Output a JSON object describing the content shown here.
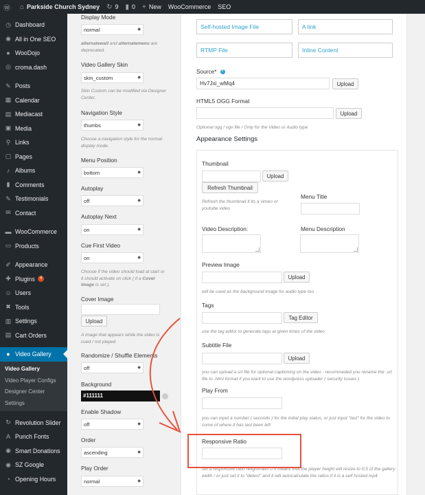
{
  "adminbar": {
    "site_name": "Parkside Church Sydney",
    "updates_count": "9",
    "comments_count": "0",
    "new_label": "New",
    "woocommerce_label": "WooCommerce",
    "seo_label": "SEO"
  },
  "sidebar": {
    "items": [
      {
        "label": "Dashboard",
        "icon": "dashboard-icon"
      },
      {
        "label": "All in One SEO",
        "icon": "seo-icon"
      },
      {
        "label": "WooDojo",
        "icon": "woodojo-icon"
      },
      {
        "label": "croma.dash",
        "icon": "croma-icon"
      },
      {
        "label": "Posts",
        "icon": "pin-icon"
      },
      {
        "label": "Calendar",
        "icon": "calendar-icon"
      },
      {
        "label": "Mediacast",
        "icon": "mediacast-icon"
      },
      {
        "label": "Media",
        "icon": "media-icon"
      },
      {
        "label": "Links",
        "icon": "links-icon"
      },
      {
        "label": "Pages",
        "icon": "pages-icon"
      },
      {
        "label": "Albums",
        "icon": "albums-icon"
      },
      {
        "label": "Comments",
        "icon": "comments-icon"
      },
      {
        "label": "Testimonials",
        "icon": "testimonials-icon"
      },
      {
        "label": "Contact",
        "icon": "contact-icon"
      },
      {
        "label": "WooCommerce",
        "icon": "woocommerce-icon"
      },
      {
        "label": "Products",
        "icon": "products-icon"
      },
      {
        "label": "Appearance",
        "icon": "appearance-icon"
      },
      {
        "label": "Plugins",
        "icon": "plugins-icon",
        "badge": "4"
      },
      {
        "label": "Users",
        "icon": "users-icon"
      },
      {
        "label": "Tools",
        "icon": "tools-icon"
      },
      {
        "label": "Settings",
        "icon": "settings-icon"
      },
      {
        "label": "Cart Orders",
        "icon": "cart-icon"
      },
      {
        "label": "Video Gallery",
        "icon": "video-gallery-icon",
        "active": true
      }
    ],
    "submenu": [
      "Video Gallery",
      "Video Player Configs",
      "Designer Center",
      "Settings"
    ],
    "items_after": [
      {
        "label": "Revolution Slider",
        "icon": "revolution-icon"
      },
      {
        "label": "Punch Fonts",
        "icon": "fonts-icon"
      },
      {
        "label": "Smart Donations",
        "icon": "donations-icon"
      },
      {
        "label": "SZ Google",
        "icon": "google-icon"
      },
      {
        "label": "Opening Hours",
        "icon": "clock-icon"
      }
    ]
  },
  "left_options": {
    "display_mode": {
      "label": "Display Mode",
      "value": "normal",
      "desc_bold1": "alternatewall",
      "desc_mid": " and ",
      "desc_bold2": "alternatemenu",
      "desc_tail": " are deprecated."
    },
    "skin": {
      "label": "Video Gallery Skin",
      "value": "skin_custom",
      "desc": "Skin Custom can be modified via Designer Center."
    },
    "navigation": {
      "label": "Navigation Style",
      "value": "thumbs",
      "desc": "Choose a navigation style for the normal display mode."
    },
    "menu_position": {
      "label": "Menu Position",
      "value": "bottom"
    },
    "autoplay": {
      "label": "Autoplay",
      "value": "off"
    },
    "autoplay_next": {
      "label": "Autoplay Next",
      "value": "on"
    },
    "cue_first": {
      "label": "Cue First Video",
      "value": "on",
      "desc_head": "Choose if the video should load at start or it should activate on click ( if a ",
      "desc_bold": "Cover Image",
      "desc_tail": " is set )."
    },
    "cover_image": {
      "label": "Cover Image",
      "upload": "Upload",
      "desc": "A image that appears while the video is cued / not played"
    },
    "randomize": {
      "label": "Randomize / Shuffle Elements",
      "value": "off"
    },
    "background": {
      "label": "Background",
      "value": "#111111"
    },
    "shadow": {
      "label": "Enable Shadow",
      "value": "off"
    },
    "order": {
      "label": "Order",
      "value": "ascending"
    },
    "play_order": {
      "label": "Play Order",
      "value": "normal"
    }
  },
  "right_panel": {
    "tabs": [
      "Self-hosted Image File",
      "A link",
      "RTMP File",
      "Inline Content"
    ],
    "source": {
      "label": "Source*",
      "value": "Hv7Jxi_wMq4",
      "upload": "Upload"
    },
    "html5_ogg": {
      "label": "HTML5 OGG Format",
      "upload": "Upload",
      "desc": "Optional ogg / ogv file / Only for the Video or Audio type"
    },
    "appearance_heading": "Appearance Settings",
    "thumbnail": {
      "label": "Thumbnail",
      "upload": "Upload",
      "refresh": "Refresh Thumbnail",
      "desc": "Refresh the thumbnail if its a vimeo or youtube video"
    },
    "menu_title": {
      "label": "Menu Title"
    },
    "video_description": {
      "label": "Video Description:"
    },
    "menu_description": {
      "label": "Menu Description"
    },
    "preview_image": {
      "label": "Preview Image",
      "upload": "Upload",
      "desc": "will be used as the background image for audio type too"
    },
    "tags": {
      "label": "Tags",
      "editor": "Tag Editor",
      "desc": "use the tag editor to generate tags at given times of the video"
    },
    "subtitle": {
      "label": "Subtitle File",
      "upload": "Upload",
      "desc": "you can upload a srt file for optional captioning on the video - recommeded you rename the .srt file to .html format if you want to use the wordpress uploader ( security issues )"
    },
    "play_from": {
      "label": "Play From",
      "desc": "you can input a number ( seconds ) for the initial play status, or just input \"last\" for the video to come of where it has last been left"
    },
    "responsive_ratio": {
      "label": "Responsive Ratio",
      "desc": "set a responsive ratio height/ratio 0.5 means that the player height will resize to 0.5 of the gallery width / or just set it to \"detect\" and it will autocalculate the ratios if it is a self hosted mp4"
    }
  },
  "colors": {
    "sidebar_bg": "#23282d",
    "active": "#0073aa",
    "annotation": "#e8503a",
    "link": "#2ea2cc"
  }
}
